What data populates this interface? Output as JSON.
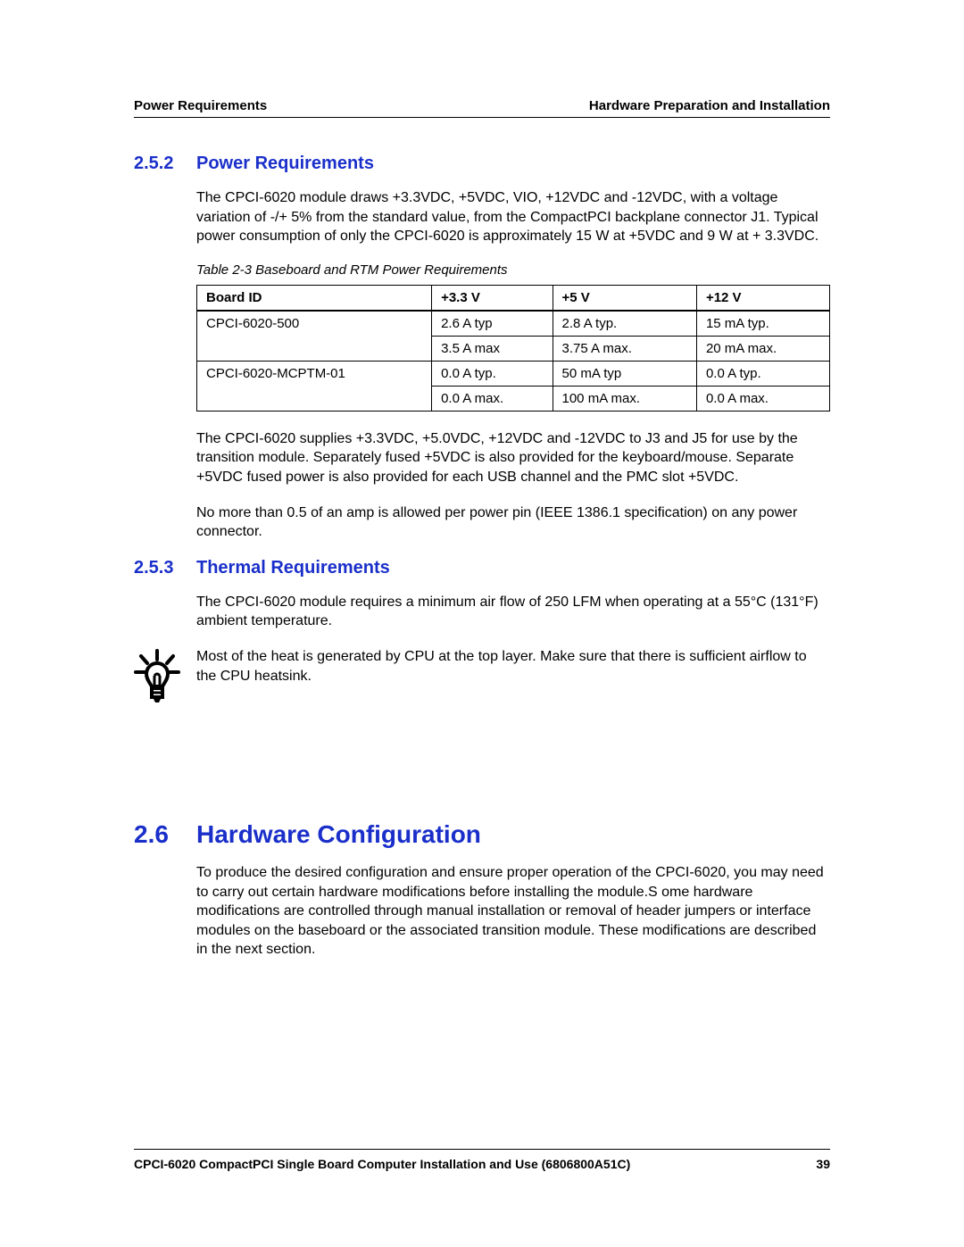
{
  "header": {
    "left": "Power Requirements",
    "right": "Hardware Preparation and Installation"
  },
  "sections": {
    "s252": {
      "num": "2.5.2",
      "title": "Power Requirements",
      "para1": "The CPCI-6020 module draws  +3.3VDC, +5VDC, VIO, +12VDC and -12VDC, with a voltage variation of -/+ 5% from the standard value, from the CompactPCI backplane connector J1. Typical power consumption of only the CPCI-6020 is approximately 15 W at +5VDC and 9 W at + 3.3VDC.",
      "table_caption": "Table 2-3 Baseboard and RTM Power Requirements",
      "table": {
        "headers": [
          "Board ID",
          "+3.3 V",
          "+5 V",
          "+12 V"
        ],
        "rows": [
          {
            "board": "CPCI-6020-500",
            "v33": "2.6 A typ",
            "v5": "2.8 A typ.",
            "v12": "15 mA typ."
          },
          {
            "board": "",
            "v33": "3.5 A max",
            "v5": "3.75 A max.",
            "v12": "20 mA max."
          },
          {
            "board": "CPCI-6020-MCPTM-01",
            "v33": "0.0 A typ.",
            "v5": "50 mA typ",
            "v12": "0.0 A typ."
          },
          {
            "board": "",
            "v33": "0.0 A max.",
            "v5": "100 mA max.",
            "v12": "0.0 A max."
          }
        ]
      },
      "para2": "The CPCI-6020 supplies +3.3VDC, +5.0VDC, +12VDC and -12VDC to J3 and J5 for use by the transition module. Separately fused +5VDC is also provided for the keyboard/mouse. Separate +5VDC fused power is also provided for each USB channel and the PMC slot +5VDC.",
      "para3": "No more than 0.5 of an amp is allowed per power pin (IEEE 1386.1 specification) on any power connector."
    },
    "s253": {
      "num": "2.5.3",
      "title": "Thermal Requirements",
      "para1": "The CPCI-6020 module requires a minimum air flow of 250 LFM when operating at a 55°C (131°F) ambient temperature.",
      "tip": "Most of the heat is generated by CPU at the top layer. Make sure that there is sufficient airflow to the CPU heatsink."
    },
    "s26": {
      "num": "2.6",
      "title": "Hardware Configuration",
      "para1": "To produce the desired configuration and ensure proper operation of the CPCI-6020, you may need to carry out certain hardware modifications before installing the module.S ome hardware modifications are controlled through manual installation or removal of header jumpers or interface modules on the baseboard or the associated transition module. These modifications are described in the next section."
    }
  },
  "footer": {
    "doc": "CPCI-6020 CompactPCI Single Board Computer Installation and Use (6806800A51C)",
    "page": "39"
  }
}
